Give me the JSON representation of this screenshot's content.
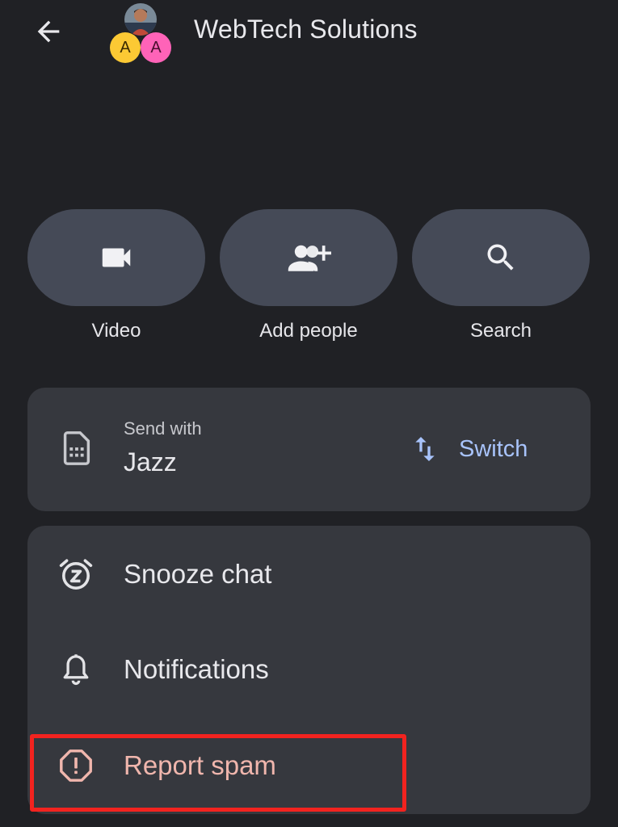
{
  "header": {
    "title": "WebTech Solutions",
    "back_icon": "arrow-left-icon",
    "avatars": [
      {
        "type": "photo",
        "icon": "user-photo"
      },
      {
        "type": "letter",
        "letter": "A",
        "color": "#fcc934"
      },
      {
        "type": "letter",
        "letter": "A",
        "color": "#ff63b8"
      }
    ]
  },
  "actions": [
    {
      "label": "Video",
      "icon": "video-camera-icon"
    },
    {
      "label": "Add people",
      "icon": "add-person-icon"
    },
    {
      "label": "Search",
      "icon": "search-icon"
    }
  ],
  "send_with": {
    "caption": "Send with",
    "carrier": "Jazz",
    "icon": "sim-card-icon",
    "switch_label": "Switch",
    "switch_icon": "swap-vertical-icon",
    "accent": "#a8c3fb"
  },
  "menu": {
    "items": [
      {
        "label": "Snooze chat",
        "icon": "alarm-snooze-icon"
      },
      {
        "label": "Notifications",
        "icon": "bell-icon"
      },
      {
        "label": "Report spam",
        "icon": "report-octagon-icon",
        "color": "#f0b6ad"
      }
    ]
  },
  "colors": {
    "background": "#202125",
    "card": "#36383e",
    "action_button": "#454a57",
    "highlight": "#f2231f"
  }
}
